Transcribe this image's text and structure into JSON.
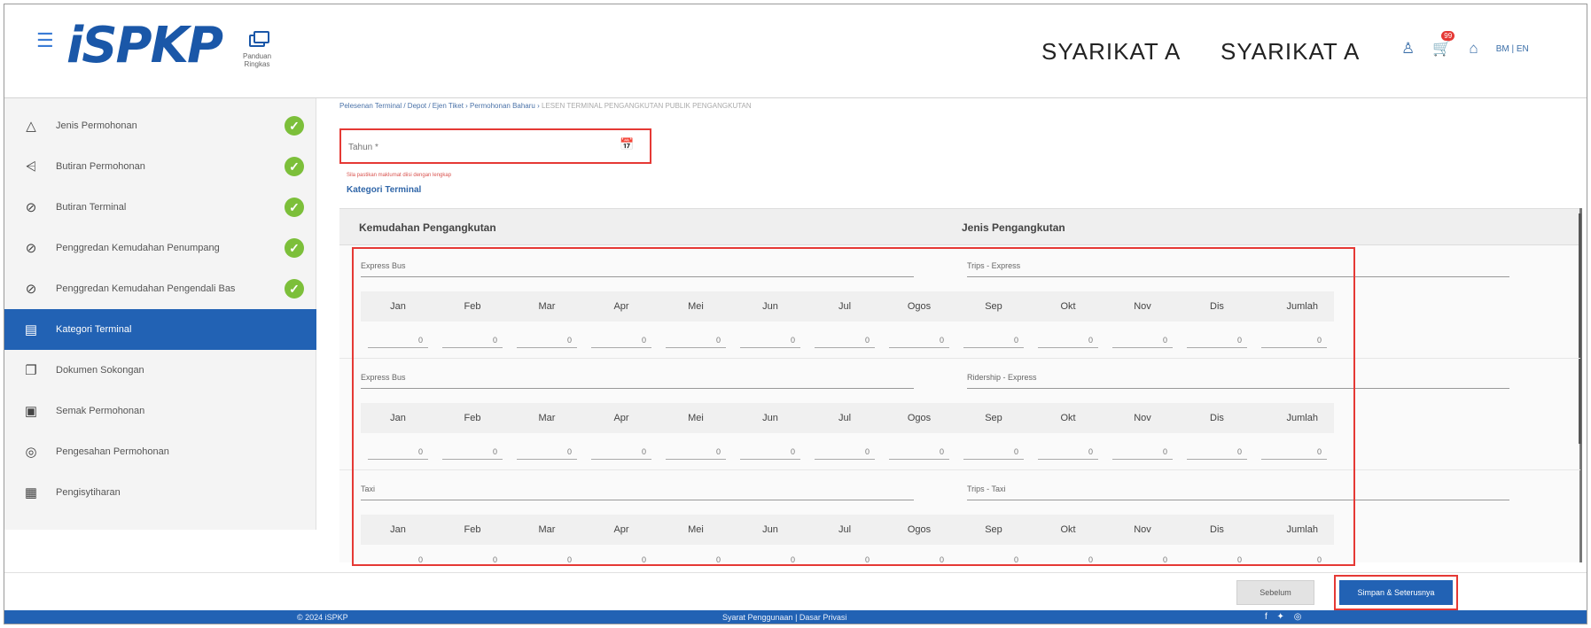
{
  "header": {
    "menu_icon": "hamburger-icon",
    "logo_text": "iSPKP",
    "help_label": "Panduan Ringkas",
    "company_1": "SYARIKAT A",
    "company_2": "SYARIKAT A",
    "user_icon": "user-icon",
    "cart_icon": "cart-icon",
    "cart_badge": "99",
    "home_icon": "home-icon",
    "language": "BM | EN"
  },
  "sidebar": {
    "items": [
      {
        "label": "Jenis Permohonan",
        "icon": "warning-triangle-icon",
        "completed": true
      },
      {
        "label": "Butiran Permohonan",
        "icon": "filter-icon",
        "completed": true
      },
      {
        "label": "Butiran Terminal",
        "icon": "check-circle-icon",
        "completed": true
      },
      {
        "label": "Penggredan Kemudahan Penumpang",
        "icon": "check-circle-icon",
        "completed": true
      },
      {
        "label": "Penggredan Kemudahan Pengendali Bas",
        "icon": "check-circle-icon",
        "completed": true
      },
      {
        "label": "Kategori Terminal",
        "icon": "document-icon",
        "completed": false,
        "active": true
      },
      {
        "label": "Dokumen Sokongan",
        "icon": "documents-icon",
        "completed": false
      },
      {
        "label": "Semak Permohonan",
        "icon": "comment-icon",
        "completed": false
      },
      {
        "label": "Pengesahan Permohonan",
        "icon": "verify-icon",
        "completed": false
      },
      {
        "label": "Pengisytiharan",
        "icon": "clipboard-icon",
        "completed": false
      }
    ]
  },
  "breadcrumb": {
    "path": "Pelesenan Terminal / Depot / Ejen Tiket › Permohonan Baharu ›",
    "current": "LESEN TERMINAL PENGANGKUTAN PUBLIK PENGANGKUTAN"
  },
  "form": {
    "tahun_placeholder": "Tahun *",
    "helper_text": "Sila pastikan maklumat diisi dengan lengkap",
    "section_title": "Kategori Terminal"
  },
  "table": {
    "header_left": "Kemudahan Pengangkutan",
    "header_right": "Jenis Pengangkutan",
    "months": [
      "Jan",
      "Feb",
      "Mar",
      "Apr",
      "Mei",
      "Jun",
      "Jul",
      "Ogos",
      "Sep",
      "Okt",
      "Nov",
      "Dis"
    ],
    "total_label": "Jumlah",
    "groups": [
      {
        "facility": "Express Bus",
        "type": "Trips - Express",
        "values": [
          "0",
          "0",
          "0",
          "0",
          "0",
          "0",
          "0",
          "0",
          "0",
          "0",
          "0",
          "0"
        ],
        "total": "0"
      },
      {
        "facility": "Express Bus",
        "type": "Ridership - Express",
        "values": [
          "0",
          "0",
          "0",
          "0",
          "0",
          "0",
          "0",
          "0",
          "0",
          "0",
          "0",
          "0"
        ],
        "total": "0"
      },
      {
        "facility": "Taxi",
        "type": "Trips - Taxi",
        "values": [
          "0",
          "0",
          "0",
          "0",
          "0",
          "0",
          "0",
          "0",
          "0",
          "0",
          "0",
          "0"
        ],
        "total": "0"
      }
    ]
  },
  "actions": {
    "prev_label": "Sebelum",
    "next_label": "Simpan & Seterusnya"
  },
  "footer": {
    "copyright": "© 2024 iSPKP",
    "terms": "Syarat Penggunaan | Dasar Privasi",
    "social": "f ✦ ◎"
  },
  "colors": {
    "primary": "#2262b4",
    "success": "#7cbf3a",
    "highlight": "#e53935"
  }
}
